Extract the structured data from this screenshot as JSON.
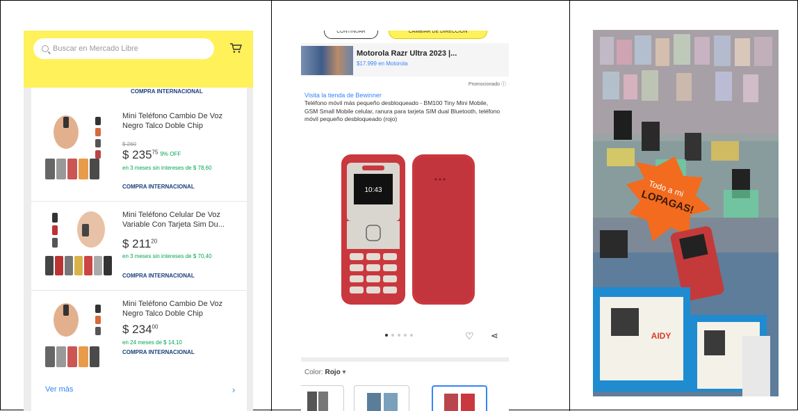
{
  "listing": {
    "search_placeholder": "Buscar en Mercado Libre",
    "top_badge": "COMPRA INTERNACIONAL",
    "products": [
      {
        "title": "Mini Teléfono Cambio De Voz Negro Talco Doble Chip",
        "old_price": "$ 260",
        "price": "$ 235",
        "cents": "75",
        "discount": "9% OFF",
        "installments": "en 3 meses sin intereses de $ 78,60",
        "badge": "COMPRA INTERNACIONAL"
      },
      {
        "title": "Mini Teléfono Celular De Voz Variable Con Tarjeta Sim Du...",
        "old_price": "",
        "price": "$ 211",
        "cents": "20",
        "discount": "",
        "installments": "en 3 meses sin intereses de $ 70,40",
        "badge": "COMPRA INTERNACIONAL"
      },
      {
        "title": "Mini Teléfono Cambio De Voz Negro Talco Doble Chip",
        "old_price": "",
        "price": "$ 234",
        "cents": "00",
        "discount": "",
        "installments": "en 24 meses de $ 14,10",
        "badge": "COMPRA INTERNACIONAL"
      }
    ],
    "see_more": "Ver más",
    "chevron": "›"
  },
  "detail": {
    "pill_left": "CONTINUAR",
    "pill_right": "CAMBIAR DE DIRECCIÓN",
    "ad_title": "Motorola Razr Ultra 2023 |...",
    "ad_subtitle": "$17.999 en Motorola",
    "promoted": "Promocionado",
    "store_link": "Visita la tienda de Bewinner",
    "description": "Teléfono móvil más pequeño desbloqueado - BM100 Tiny Mini Mobile, GSM Small Mobile celular, ranura para tarjeta SIM dual Bluetooth, teléfono móvil pequeño desbloqueado (rojo)",
    "color_label": "Color:",
    "color_value": "Rojo",
    "screen_time": "10:43",
    "phone_color": "#c9383e"
  },
  "photo": {
    "sign_line1": "Todo a mi",
    "sign_line2": "LOPAGAS!",
    "box_label": "AIDY"
  }
}
